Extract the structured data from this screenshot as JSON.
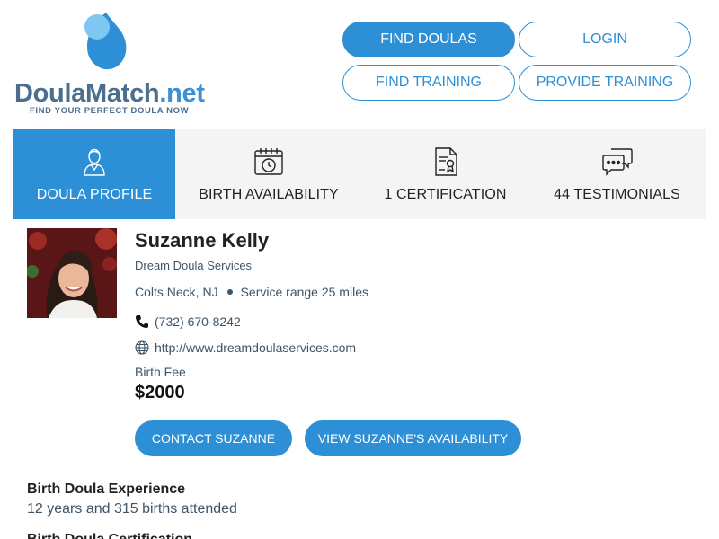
{
  "logo": {
    "name_main": "DoulaMatch",
    "name_suffix": ".net",
    "tagline": "FIND YOUR PERFECT DOULA NOW"
  },
  "nav": {
    "find_doulas": "FIND DOULAS",
    "login": "LOGIN",
    "find_training": "FIND TRAINING",
    "provide_training": "PROVIDE TRAINING"
  },
  "tabs": [
    {
      "label": "DOULA PROFILE",
      "icon": "doula-icon"
    },
    {
      "label": "BIRTH AVAILABILITY",
      "icon": "calendar-clock-icon"
    },
    {
      "label": "1 CERTIFICATION",
      "icon": "certificate-icon"
    },
    {
      "label": "44 TESTIMONIALS",
      "icon": "chat-bubbles-icon"
    }
  ],
  "profile": {
    "name": "Suzanne Kelly",
    "agency": "Dream Doula Services",
    "location": "Colts Neck, NJ",
    "service_range": "Service range 25 miles",
    "phone": "(732) 670-8242",
    "website": "http://www.dreamdoulaservices.com",
    "fee_label": "Birth Fee",
    "fee_value": "$2000"
  },
  "actions": {
    "contact": "CONTACT SUZANNE",
    "availability": "VIEW SUZANNE'S AVAILABILITY"
  },
  "experience": {
    "title": "Birth Doula Experience",
    "text": "12 years and 315 births attended"
  },
  "next_section": {
    "title": "Birth Doula Certification"
  },
  "colors": {
    "accent": "#2d8fd5",
    "tab_background": "#f4f4f4",
    "text_muted": "#3e5568",
    "logo_text": "#4b6d8e"
  }
}
